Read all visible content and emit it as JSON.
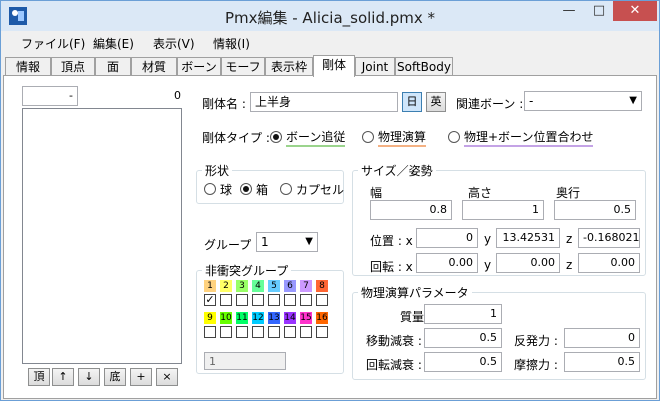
{
  "window": {
    "title": "Pmx編集 - Alicia_solid.pmx *"
  },
  "menu": [
    "ファイル(F)",
    "編集(E)",
    "表示(V)",
    "情報(I)"
  ],
  "tabs": [
    "情報",
    "頂点",
    "面",
    "材質",
    "ボーン",
    "モーフ",
    "表示枠",
    "剛体",
    "Joint",
    "SoftBody"
  ],
  "active_tab": "剛体",
  "list": {
    "filter_value": "-",
    "count": "0"
  },
  "list_buttons": [
    "頂",
    "↑",
    "↓",
    "底",
    "+",
    "×"
  ],
  "body": {
    "name_label": "剛体名 :",
    "name_value": "上半身",
    "lang_jp": "日",
    "lang_en": "英",
    "bone_label": "関連ボーン :",
    "bone_value": "-"
  },
  "type": {
    "label": "剛体タイプ :",
    "options": [
      "ボーン追従",
      "物理演算",
      "物理+ボーン位置合わせ"
    ],
    "selected": 0
  },
  "shape": {
    "label": "形状",
    "options": [
      "球",
      "箱",
      "カプセル"
    ],
    "selected": 1
  },
  "group": {
    "label": "グループ :",
    "value": "1"
  },
  "nocollide": {
    "label": "非衝突グループ",
    "row1": [
      "1",
      "2",
      "3",
      "4",
      "5",
      "6",
      "7",
      "8"
    ],
    "row2": [
      "9",
      "10",
      "11",
      "12",
      "13",
      "14",
      "15",
      "16"
    ],
    "row1_colors": [
      "#ffd27f",
      "#ffff66",
      "#99ff66",
      "#66ff99",
      "#66ccff",
      "#9999ff",
      "#cc99ff",
      "#ff6633"
    ],
    "row2_colors": [
      "#ffff00",
      "#66ff00",
      "#00ff66",
      "#00ccff",
      "#3366ff",
      "#9933ff",
      "#ff33cc",
      "#ff6600"
    ],
    "checked": [
      "1"
    ],
    "text_value": "1"
  },
  "size": {
    "label": "サイズ／姿勢",
    "width_label": "幅",
    "height_label": "高さ",
    "depth_label": "奥行",
    "width": "0.8",
    "height": "1",
    "depth": "0.5",
    "pos_label": "位置 : x",
    "pos_x": "0",
    "pos_y": "13.42531",
    "pos_z": "-0.168021",
    "rot_label": "回転 : x",
    "rot_x": "0.00",
    "rot_y": "0.00",
    "rot_z": "0.00",
    "y_label": "y",
    "z_label": "z"
  },
  "physics": {
    "label": "物理演算パラメータ",
    "mass_label": "質量 :",
    "mass": "1",
    "move_damp_label": "移動減衰 :",
    "move_damp": "0.5",
    "restitution_label": "反発力 :",
    "restitution": "0",
    "rot_damp_label": "回転減衰 :",
    "rot_damp": "0.5",
    "friction_label": "摩擦力 :",
    "friction": "0.5"
  }
}
